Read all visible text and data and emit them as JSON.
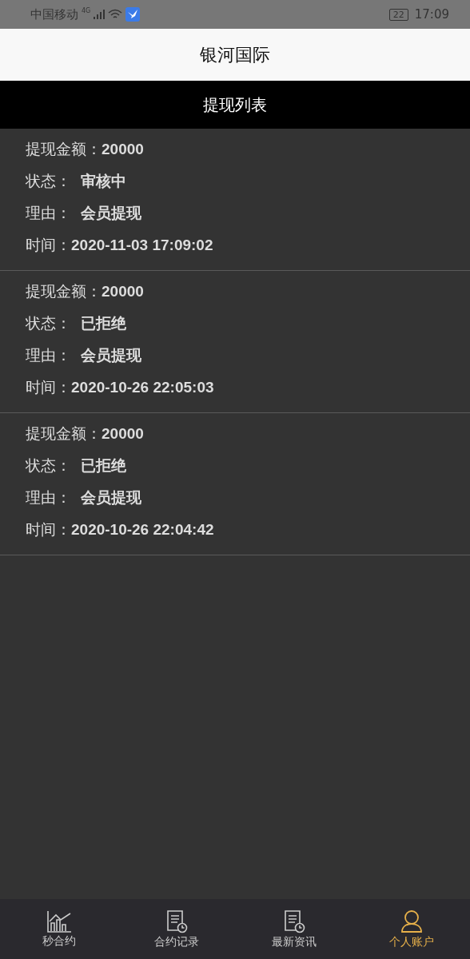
{
  "status_bar": {
    "carrier": "中国移动",
    "network": "4G",
    "battery": "22",
    "time": "17:09"
  },
  "header": {
    "title": "银河国际"
  },
  "section": {
    "title": "提现列表"
  },
  "records": [
    {
      "fields": [
        {
          "label": "提现金额：",
          "value": "20000"
        },
        {
          "label": "状态：",
          "value": "审核中"
        },
        {
          "label": "理由：",
          "value": "会员提现"
        },
        {
          "label": "时间：",
          "value": "2020-11-03 17:09:02"
        }
      ]
    },
    {
      "fields": [
        {
          "label": "提现金额：",
          "value": "20000"
        },
        {
          "label": "状态：",
          "value": "已拒绝"
        },
        {
          "label": "理由：",
          "value": "会员提现"
        },
        {
          "label": "时间：",
          "value": "2020-10-26 22:05:03"
        }
      ]
    },
    {
      "fields": [
        {
          "label": "提现金额：",
          "value": "20000"
        },
        {
          "label": "状态：",
          "value": "已拒绝"
        },
        {
          "label": "理由：",
          "value": "会员提现"
        },
        {
          "label": "时间：",
          "value": "2020-10-26 22:04:42"
        }
      ]
    }
  ],
  "tab_bar": [
    {
      "kind": "chart",
      "label": "秒合约",
      "selected": false
    },
    {
      "kind": "doc",
      "label": "合约记录",
      "selected": false
    },
    {
      "kind": "doc",
      "label": "最新资讯",
      "selected": false
    },
    {
      "kind": "user",
      "label": "个人账户",
      "selected": true
    }
  ]
}
